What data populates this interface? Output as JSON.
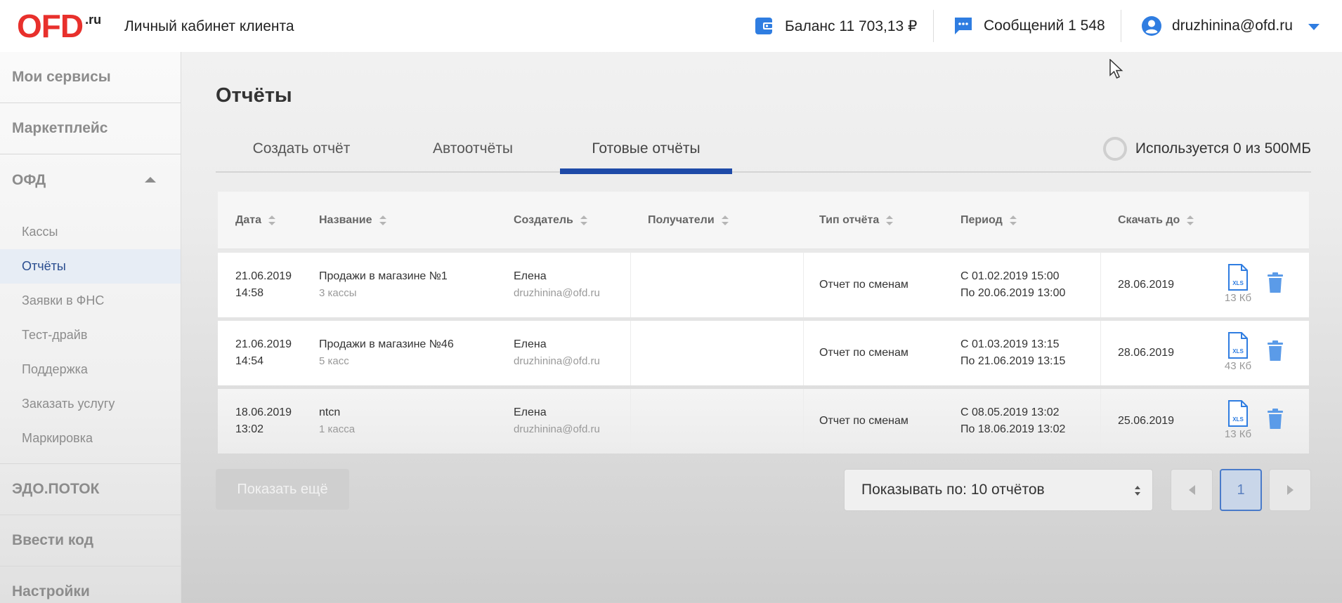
{
  "header": {
    "logo_main": "OFD",
    "logo_suffix": ".ru",
    "title": "Личный кабинет клиента",
    "balance": "Баланс 11 703,13 ₽",
    "messages": "Сообщений 1 548",
    "user_email": "druzhinina@ofd.ru",
    "accent_color": "#2f7de1"
  },
  "sidebar": {
    "my_services": "Мои сервисы",
    "marketplace": "Маркетплейс",
    "ofd": "ОФД",
    "ofd_items": [
      "Кассы",
      "Отчёты",
      "Заявки в ФНС",
      "Тест-драйв",
      "Поддержка",
      "Заказать услугу",
      "Маркировка"
    ],
    "active_item": "Отчёты",
    "edo": "ЭДО.ПОТОК",
    "enter_code": "Ввести код",
    "settings": "Настройки"
  },
  "main": {
    "page_title": "Отчёты",
    "tabs": [
      "Создать отчёт",
      "Автоотчёты",
      "Готовые отчёты"
    ],
    "active_tab": "Готовые отчёты",
    "usage": "Используется 0 из 500МБ"
  },
  "table": {
    "columns": [
      "Дата",
      "Название",
      "Создатель",
      "Получатели",
      "Тип отчёта",
      "Период",
      "Скачать до"
    ],
    "rows": [
      {
        "date": "21.06.2019",
        "time": "14:58",
        "name": "Продажи в магазине №1",
        "kassy": "3 кассы",
        "creator": "Елена",
        "creator_email": "druzhinina@ofd.ru",
        "recipients": "",
        "type": "Отчет по сменам",
        "period_from": "С 01.02.2019 15:00",
        "period_to": "По 20.06.2019 13:00",
        "download_until": "28.06.2019",
        "file_size": "13 Кб"
      },
      {
        "date": "21.06.2019",
        "time": "14:54",
        "name": "Продажи в магазине №46",
        "kassy": "5 касс",
        "creator": "Елена",
        "creator_email": "druzhinina@ofd.ru",
        "recipients": "",
        "type": "Отчет по сменам",
        "period_from": "С 01.03.2019 13:15",
        "period_to": "По 21.06.2019 13:15",
        "download_until": "28.06.2019",
        "file_size": "43 Кб"
      },
      {
        "date": "18.06.2019",
        "time": "13:02",
        "name": "ntcn",
        "kassy": "1 касса",
        "creator": "Елена",
        "creator_email": "druzhinina@ofd.ru",
        "recipients": "",
        "type": "Отчет по сменам",
        "period_from": "С 08.05.2019 13:02",
        "period_to": "По 18.06.2019 13:02",
        "download_until": "25.06.2019",
        "file_size": "13 Кб"
      }
    ],
    "file_icon_label": "XLS"
  },
  "footer": {
    "show_more": "Показать ещё",
    "per_page": "Показывать по: 10 отчётов",
    "current_page": "1"
  }
}
